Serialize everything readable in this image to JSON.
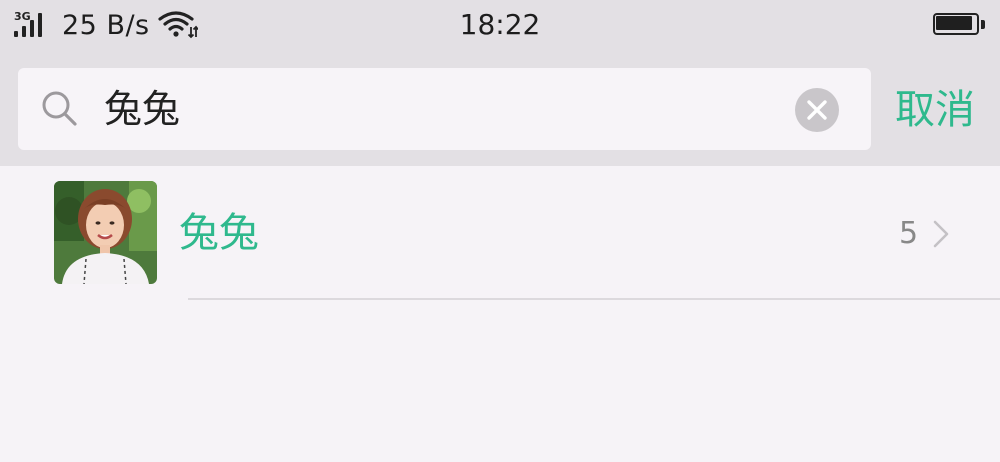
{
  "status_bar": {
    "network": "3G",
    "speed": "25 B/s",
    "time": "18:22"
  },
  "search": {
    "query": "兔兔",
    "cancel_label": "取消"
  },
  "results": [
    {
      "name": "兔兔",
      "count": "5"
    }
  ],
  "colors": {
    "accent": "#2fb98d",
    "background": "#f6f3f7",
    "header": "#e3e0e4"
  },
  "icons": [
    "signal-icon",
    "wifi-icon",
    "battery-icon",
    "search-icon",
    "clear-icon",
    "chevron-right-icon"
  ]
}
